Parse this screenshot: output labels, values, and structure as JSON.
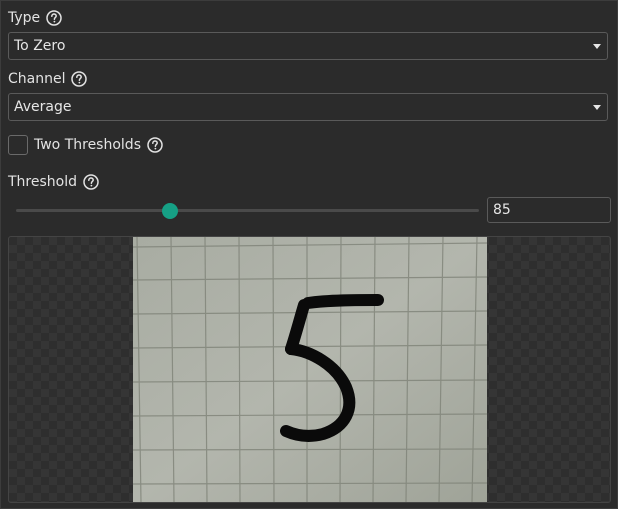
{
  "type_section": {
    "label": "Type",
    "selected": "To Zero"
  },
  "channel_section": {
    "label": "Channel",
    "selected": "Average"
  },
  "two_thresholds": {
    "label": "Two Thresholds",
    "checked": false
  },
  "threshold_section": {
    "label": "Threshold",
    "value": "85",
    "slider_fraction": 0.333
  },
  "colors": {
    "accent": "#16a085",
    "background": "#2b2b2b"
  },
  "preview": {
    "image": "thresholded-handwritten-digit-on-grid-paper"
  }
}
